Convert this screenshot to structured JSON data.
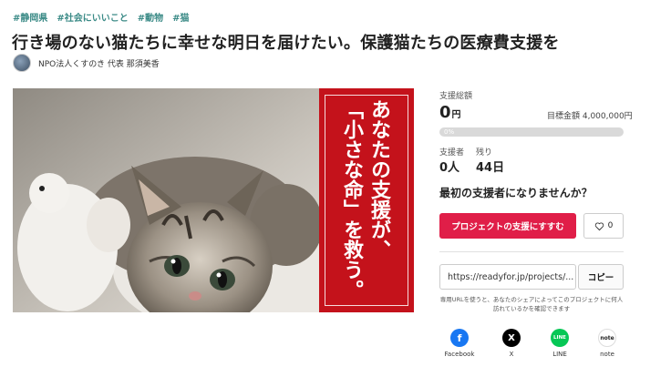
{
  "tags": [
    "#静岡県",
    "#社会にいいこと",
    "#動物",
    "#猫"
  ],
  "title": "行き場のない猫たちに幸せな明日を届けたい。保護猫たちの医療費支援を",
  "owner": "NPO法人くすのき 代表 那須美香",
  "hero": {
    "line1": "あなたの支援が、",
    "line2": "「小さな命」を救う。"
  },
  "stats": {
    "total_label": "支援総額",
    "total_value": "0",
    "total_unit": "円",
    "goal": "目標金額 4,000,000円",
    "progress_label": "0%",
    "progress": 0,
    "supporters_label": "支援者",
    "supporters_value": "0人",
    "remaining_label": "残り",
    "remaining_value": "44日"
  },
  "prompt": "最初の支援者になりませんか？",
  "support_button": "プロジェクトの支援にすすむ",
  "favorite_count": "0",
  "share": {
    "url": "https://readyfor.jp/projects/...",
    "copy_label": "コピー",
    "note": "専用URLを使うと、あなたのシェアによってこのプロジェクトに何人訪れているかを確認できます",
    "items": [
      {
        "label": "Facebook",
        "color": "#1877f2",
        "glyph": "f"
      },
      {
        "label": "X",
        "color": "#000000",
        "glyph": "X"
      },
      {
        "label": "LINE",
        "color": "#06c755",
        "glyph": "LINE"
      },
      {
        "label": "note",
        "color": "#ffffff",
        "glyph": "note"
      }
    ]
  },
  "colors": {
    "accent": "#e01e48",
    "hero_red": "#c4121b",
    "tag": "#3a8a86"
  }
}
